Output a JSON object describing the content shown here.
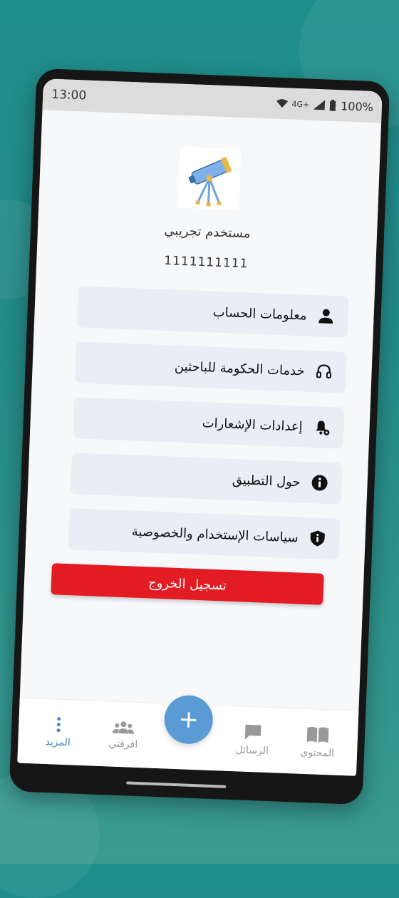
{
  "status": {
    "time": "13:00",
    "network": "4G+",
    "battery": "100%"
  },
  "profile": {
    "name": "مستخدم تجريبي",
    "id": "1111111111"
  },
  "menu": [
    {
      "label": "معلومات الحساب",
      "icon": "person-icon"
    },
    {
      "label": "خدمات الحكومة للباحثين",
      "icon": "headset-icon"
    },
    {
      "label": "إعدادات الإشعارات",
      "icon": "bell-settings-icon"
    },
    {
      "label": "حول التطبيق",
      "icon": "info-icon"
    },
    {
      "label": "سياسات الإستخدام والخصوصية",
      "icon": "shield-info-icon"
    }
  ],
  "logout_label": "تسجيل الخروج",
  "nav": {
    "more": "المزيد",
    "teams": "افرقتي",
    "add": "+",
    "messages": "الرسائل",
    "content": "المحتوى"
  },
  "colors": {
    "accent": "#4a84c0",
    "danger": "#e31b23",
    "card": "#e9eef5"
  }
}
